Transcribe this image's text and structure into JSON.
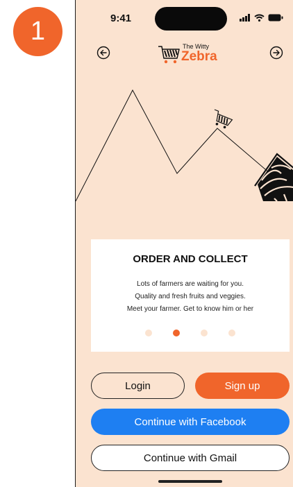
{
  "step": {
    "number": "1"
  },
  "status": {
    "time": "9:41"
  },
  "header": {
    "brand_small": "The Witty",
    "brand_big": "Zebra"
  },
  "card": {
    "title": "ORDER AND COLLECT",
    "body_lines": [
      "Lots of farmers are waiting for you.",
      "Quality and fresh fruits and veggies.",
      "Meet your farmer. Get to know him or her"
    ],
    "pagination": {
      "total": 4,
      "active_index": 1
    }
  },
  "buttons": {
    "login": "Login",
    "signup": "Sign up",
    "facebook": "Continue with Facebook",
    "gmail": "Continue with Gmail"
  },
  "colors": {
    "background": "#FBE3D0",
    "accent": "#F0652B",
    "facebook": "#1E7FF2"
  },
  "icons": {
    "back": "arrow-left-circle-icon",
    "forward": "arrow-right-circle-icon",
    "logo": "zebra-cart-icon"
  }
}
